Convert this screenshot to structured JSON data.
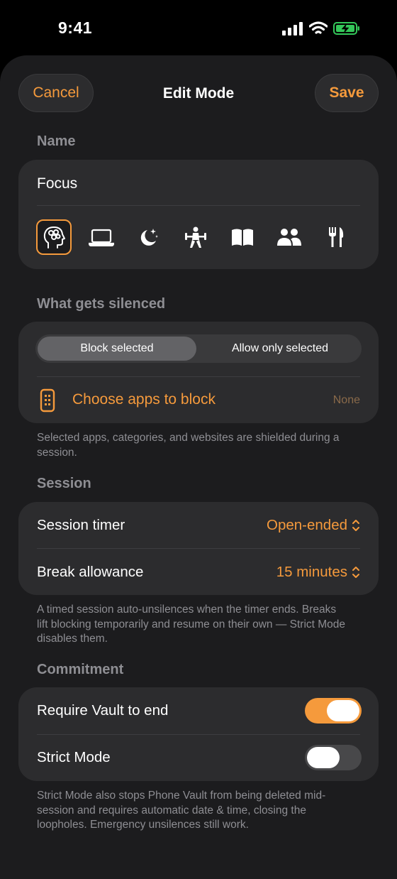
{
  "status_bar": {
    "time": "9:41"
  },
  "nav": {
    "cancel_label": "Cancel",
    "title": "Edit Mode",
    "save_label": "Save"
  },
  "name_section": {
    "label": "Name",
    "value": "Focus",
    "icons": [
      "brain-icon",
      "laptop-icon",
      "moon-stars-icon",
      "weightlifter-icon",
      "book-icon",
      "people-icon",
      "fork-knife-icon"
    ],
    "selected_icon": "brain-icon"
  },
  "silenced_section": {
    "label": "What gets silenced",
    "segments": [
      "Block selected",
      "Allow only selected"
    ],
    "selected_segment": "Block selected",
    "choose_label": "Choose apps to block",
    "choose_value": "None",
    "footnote": "Selected apps, categories, and websites are shielded during a session."
  },
  "session_section": {
    "label": "Session",
    "timer_label": "Session timer",
    "timer_value": "Open-ended",
    "break_label": "Break allowance",
    "break_value": "15 minutes",
    "footnote": "A timed session auto-unsilences when the timer ends. Breaks lift blocking temporarily and resume on their own — Strict Mode disables them."
  },
  "commitment_section": {
    "label": "Commitment",
    "vault_label": "Require Vault to end",
    "vault_on": true,
    "strict_label": "Strict Mode",
    "strict_on": false,
    "footnote": "Strict Mode also stops Phone Vault from being deleted mid-session and requires automatic date & time, closing the loopholes. Emergency unsilences still work."
  },
  "colors": {
    "accent": "#f59a3c",
    "background": "#1c1c1e",
    "card": "#2c2c2e",
    "secondary_text": "#8e8e93"
  }
}
